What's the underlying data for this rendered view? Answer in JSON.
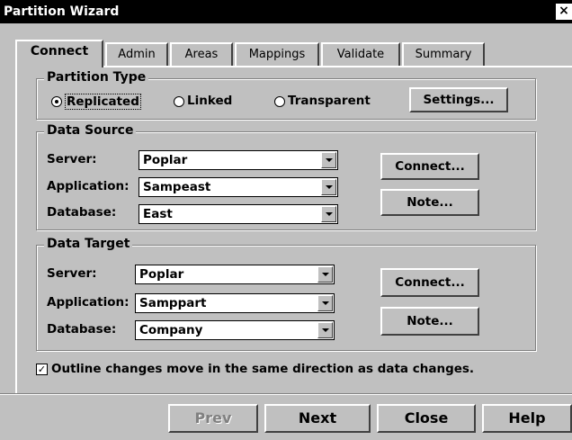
{
  "window": {
    "title": "Partition Wizard",
    "close_glyph": "×"
  },
  "tabs": [
    {
      "label": "Connect",
      "active": true
    },
    {
      "label": "Admin"
    },
    {
      "label": "Areas"
    },
    {
      "label": "Mappings"
    },
    {
      "label": "Validate"
    },
    {
      "label": "Summary"
    }
  ],
  "partition_type": {
    "legend": "Partition Type",
    "options": [
      {
        "label": "Replicated",
        "selected": true
      },
      {
        "label": "Linked"
      },
      {
        "label": "Transparent"
      }
    ],
    "settings_label": "Settings..."
  },
  "data_source": {
    "legend": "Data Source",
    "server_label": "Server:",
    "server_value": "Poplar",
    "application_label": "Application:",
    "application_value": "Sampeast",
    "database_label": "Database:",
    "database_value": "East",
    "connect_label": "Connect...",
    "note_label": "Note..."
  },
  "data_target": {
    "legend": "Data Target",
    "server_label": "Server:",
    "server_value": "Poplar",
    "application_label": "Application:",
    "application_value": "Samppart",
    "database_label": "Database:",
    "database_value": "Company",
    "connect_label": "Connect...",
    "note_label": "Note..."
  },
  "outline_option": {
    "label": "Outline changes move in the same direction as data changes.",
    "checked": true,
    "check_glyph": "✓"
  },
  "footer": {
    "prev_label": "Prev",
    "next_label": "Next",
    "close_label": "Close",
    "help_label": "Help"
  },
  "colors": {
    "face": "#c0c0c0",
    "title_bar": "#000000",
    "shadow": "#404040",
    "disabled_text": "#808080"
  }
}
